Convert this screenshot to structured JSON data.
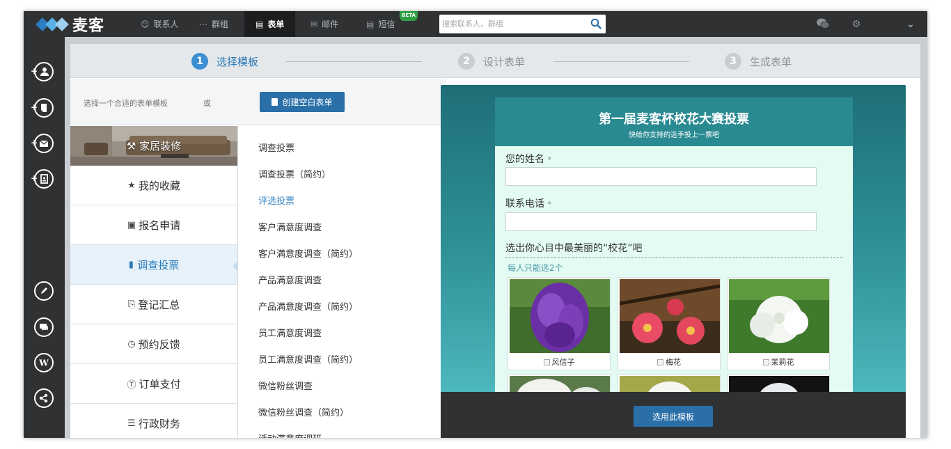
{
  "brand": {
    "name": "麦客",
    "colors": [
      "#5ab0e6",
      "#2e7cc4",
      "#9ed0f0"
    ]
  },
  "nav": {
    "items": [
      {
        "label": "联系人",
        "icon": "person-icon"
      },
      {
        "label": "群组",
        "icon": "grid-icon"
      },
      {
        "label": "表单",
        "icon": "form-icon",
        "active": true
      },
      {
        "label": "邮件",
        "icon": "mail-icon"
      },
      {
        "label": "短信",
        "icon": "chat-icon",
        "badge": "BETA"
      }
    ],
    "search_placeholder": "搜索联系人、群组"
  },
  "rail": {
    "buttons": [
      "add-contact-icon",
      "add-form-icon",
      "add-mail-icon",
      "add-card-icon",
      "edit-icon",
      "message-icon",
      "wordpress-icon",
      "share-icon"
    ]
  },
  "steps": [
    {
      "num": "1",
      "label": "选择模板",
      "active": true
    },
    {
      "num": "2",
      "label": "设计表单"
    },
    {
      "num": "3",
      "label": "生成表单"
    }
  ],
  "subbar": {
    "hint": "选择一个合适的表单模板",
    "or": "或",
    "create_label": "创建空白表单"
  },
  "categories": [
    {
      "label": "家居装修",
      "icon": "hammer-icon",
      "banner": true
    },
    {
      "label": "我的收藏",
      "icon": "star-icon"
    },
    {
      "label": "报名申请",
      "icon": "id-card-icon"
    },
    {
      "label": "调查投票",
      "icon": "bar-chart-icon",
      "active": true
    },
    {
      "label": "登记汇总",
      "icon": "clipboard-icon"
    },
    {
      "label": "预约反馈",
      "icon": "history-icon"
    },
    {
      "label": "订单支付",
      "icon": "dollar-icon"
    },
    {
      "label": "行政财务",
      "icon": "layers-icon"
    }
  ],
  "templates": [
    {
      "label": "调查投票"
    },
    {
      "label": "调查投票（简约）"
    },
    {
      "label": "评选投票",
      "active": true
    },
    {
      "label": "客户满意度调查"
    },
    {
      "label": "客户满意度调查（简约）"
    },
    {
      "label": "产品满意度调查"
    },
    {
      "label": "产品满意度调查（简约）"
    },
    {
      "label": "员工满意度调查"
    },
    {
      "label": "员工满意度调查（简约）"
    },
    {
      "label": "微信粉丝调查"
    },
    {
      "label": "微信粉丝调查（简约）"
    },
    {
      "label": "活动满意度调研"
    }
  ],
  "preview": {
    "title": "第一届麦客杯校花大赛投票",
    "subtitle": "快给你支持的选手投上一票吧",
    "fields": [
      {
        "label": "您的姓名",
        "required": "*"
      },
      {
        "label": "联系电话",
        "required": "*"
      }
    ],
    "question": "选出你心目中最美丽的“校花”吧",
    "note": "每人只能选2个",
    "options": [
      "风信子",
      "梅花",
      "茉莉花"
    ],
    "use_label": "选用此模板"
  }
}
